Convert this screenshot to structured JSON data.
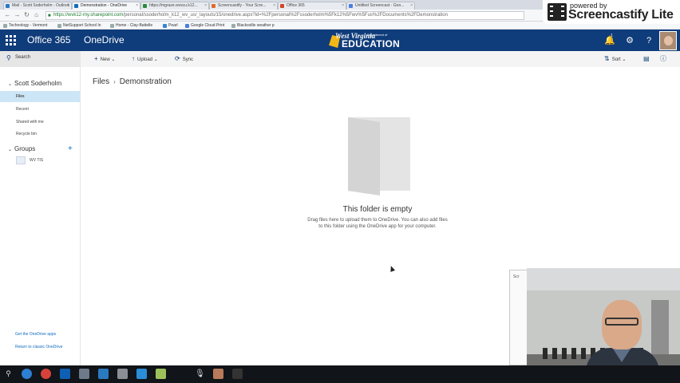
{
  "browser": {
    "tabs": [
      {
        "label": "Mail - Scott Soderholm - Outlook"
      },
      {
        "label": "Demonstration - OneDrive"
      },
      {
        "label": "https://mgraze.wvscu.k12..."
      },
      {
        "label": "Screencastify - Your Scre..."
      },
      {
        "label": "Office 365"
      },
      {
        "label": "Untitled Screencast - Goo..."
      }
    ],
    "url_host": "https://wvk12-my.sharepoint.com",
    "url_path": "/personal/ssoderholm_k12_wv_us/_layouts/15/onedrive.aspx?id=%2Fpersonal%2Fssoderholm%5Fk12%5Fwv%5Fus%2FDocuments%2FDemonstration",
    "bookmarks": [
      {
        "label": "Technology - Vermont"
      },
      {
        "label": "NetSupport School In"
      },
      {
        "label": "Home - Clay-Battelle"
      },
      {
        "label": "Pearl"
      },
      {
        "label": "Google Cloud Print"
      },
      {
        "label": "Blacksville weather p"
      }
    ]
  },
  "screencastify": {
    "small": "powered by",
    "big": "Screencastify Lite",
    "panel_label": "Scr"
  },
  "suite": {
    "app_launcher": "app-launcher",
    "product": "Office 365",
    "app": "OneDrive",
    "logo_line1": "West Virginia",
    "logo_line2": "Department of",
    "logo_line3": "EDUCATION",
    "notification_count": "1"
  },
  "search": {
    "label": "Search"
  },
  "commands": {
    "new": "New",
    "upload": "Upload",
    "sync": "Sync",
    "sort": "Sort"
  },
  "nav": {
    "user": "Scott Soderholm",
    "items": [
      {
        "label": "Files"
      },
      {
        "label": "Recent"
      },
      {
        "label": "Shared with me"
      },
      {
        "label": "Recycle bin"
      }
    ],
    "groups_label": "Groups",
    "groups": [
      {
        "label": "WV TIS"
      }
    ],
    "get_apps": "Get the OneDrive apps",
    "classic": "Return to classic OneDrive"
  },
  "main": {
    "breadcrumb_root": "Files",
    "breadcrumb_current": "Demonstration",
    "empty_title": "This folder is empty",
    "empty_desc_1": "Drag files here to upload them to OneDrive. You can also add files",
    "empty_desc_2": "to this folder using the OneDrive app for your computer."
  },
  "colors": {
    "suite_bar": "#0f3c7a",
    "accent": "#0f6cbd",
    "selected_nav": "#cde6f7"
  }
}
